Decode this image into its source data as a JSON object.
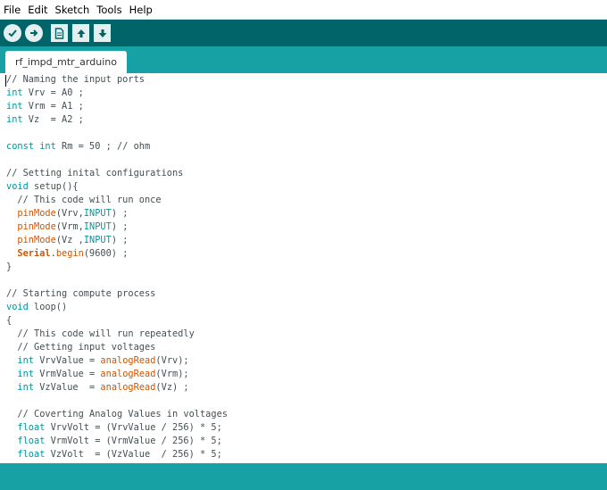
{
  "menu": [
    "File",
    "Edit",
    "Sketch",
    "Tools",
    "Help"
  ],
  "toolbar": {
    "buttons": [
      "verify-icon",
      "upload-icon",
      "new-icon",
      "open-icon",
      "save-icon"
    ],
    "bg_color": "#006468",
    "button_color": "#e4eff0"
  },
  "tab": {
    "label": "rf_impd_mtr_arduino"
  },
  "colors": {
    "keyword": "#00979d",
    "function": "#d35400",
    "text": "#434f54",
    "tabbar": "#17a1a5"
  },
  "code_lines": [
    [
      [
        "c",
        "// Naming the input ports"
      ]
    ],
    [
      [
        "k",
        "int"
      ],
      [
        "p",
        " Vrv = A0 ;"
      ]
    ],
    [
      [
        "k",
        "int"
      ],
      [
        "p",
        " Vrm = A1 ;"
      ]
    ],
    [
      [
        "k",
        "int"
      ],
      [
        "p",
        " Vz  = A2 ;"
      ]
    ],
    [],
    [
      [
        "k",
        "const"
      ],
      [
        "p",
        " "
      ],
      [
        "k",
        "int"
      ],
      [
        "p",
        " Rm = 50 ; // ohm"
      ]
    ],
    [],
    [
      [
        "c",
        "// Setting inital configurations"
      ]
    ],
    [
      [
        "k",
        "void"
      ],
      [
        "p",
        " setup(){"
      ]
    ],
    [
      [
        "c",
        "  // This code will run once"
      ]
    ],
    [
      [
        "p",
        "  "
      ],
      [
        "f",
        "pinMode"
      ],
      [
        "p",
        "(Vrv,"
      ],
      [
        "n",
        "INPUT"
      ],
      [
        "p",
        ") ;"
      ]
    ],
    [
      [
        "p",
        "  "
      ],
      [
        "f",
        "pinMode"
      ],
      [
        "p",
        "(Vrm,"
      ],
      [
        "n",
        "INPUT"
      ],
      [
        "p",
        ") ;"
      ]
    ],
    [
      [
        "p",
        "  "
      ],
      [
        "f",
        "pinMode"
      ],
      [
        "p",
        "(Vz ,"
      ],
      [
        "n",
        "INPUT"
      ],
      [
        "p",
        ") ;"
      ]
    ],
    [
      [
        "p",
        "  "
      ],
      [
        "s",
        "Serial"
      ],
      [
        "p",
        "."
      ],
      [
        "f",
        "begin"
      ],
      [
        "p",
        "(9600) ;"
      ]
    ],
    [
      [
        "p",
        "}"
      ]
    ],
    [],
    [
      [
        "c",
        "// Starting compute process"
      ]
    ],
    [
      [
        "k",
        "void"
      ],
      [
        "p",
        " loop()"
      ]
    ],
    [
      [
        "p",
        "{"
      ]
    ],
    [
      [
        "c",
        "  // This code will run repeatedly"
      ]
    ],
    [
      [
        "c",
        "  // Getting input voltages"
      ]
    ],
    [
      [
        "p",
        "  "
      ],
      [
        "k",
        "int"
      ],
      [
        "p",
        " VrvValue = "
      ],
      [
        "f",
        "analogRead"
      ],
      [
        "p",
        "(Vrv);"
      ]
    ],
    [
      [
        "p",
        "  "
      ],
      [
        "k",
        "int"
      ],
      [
        "p",
        " VrmValue = "
      ],
      [
        "f",
        "analogRead"
      ],
      [
        "p",
        "(Vrm);"
      ]
    ],
    [
      [
        "p",
        "  "
      ],
      [
        "k",
        "int"
      ],
      [
        "p",
        " VzValue  = "
      ],
      [
        "f",
        "analogRead"
      ],
      [
        "p",
        "(Vz) ;"
      ]
    ],
    [],
    [
      [
        "c",
        "  // Coverting Analog Values in voltages"
      ]
    ],
    [
      [
        "p",
        "  "
      ],
      [
        "k",
        "float"
      ],
      [
        "p",
        " VrvVolt = (VrvValue / 256) * 5;"
      ]
    ],
    [
      [
        "p",
        "  "
      ],
      [
        "k",
        "float"
      ],
      [
        "p",
        " VrmVolt = (VrmValue / 256) * 5;"
      ]
    ],
    [
      [
        "p",
        "  "
      ],
      [
        "k",
        "float"
      ],
      [
        "p",
        " VzVolt  = (VzValue  / 256) * 5;"
      ]
    ]
  ]
}
